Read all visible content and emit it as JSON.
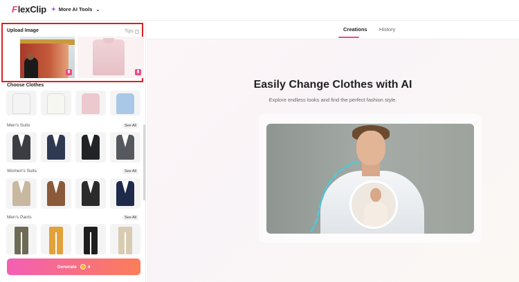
{
  "app": {
    "logo_text": "lexClip",
    "logo_mark": "F"
  },
  "topbar": {
    "more_tools_label": "More AI Tools",
    "more_tools_icon": "sparkle-icon"
  },
  "upload": {
    "title": "Upload Image",
    "tips_label": "Tips"
  },
  "choose_clothes": {
    "title": "Choose Clothes"
  },
  "sections": [
    {
      "label": "Men's Suits",
      "see_all": "See All"
    },
    {
      "label": "Women's Suits",
      "see_all": "See All"
    },
    {
      "label": "Men's Pants",
      "see_all": "See All"
    }
  ],
  "generate": {
    "label": "Generate",
    "credits": "4"
  },
  "tabs": [
    {
      "label": "Creations",
      "active": true
    },
    {
      "label": "History",
      "active": false
    }
  ],
  "hero": {
    "title": "Easily Change Clothes with AI",
    "subtitle": "Explore endless looks and find the perfect fashion style."
  },
  "colors": {
    "accent": "#e94b8a",
    "highlight_border": "#d92020",
    "generate_start": "#f35fb4",
    "generate_end": "#fb7d58"
  }
}
